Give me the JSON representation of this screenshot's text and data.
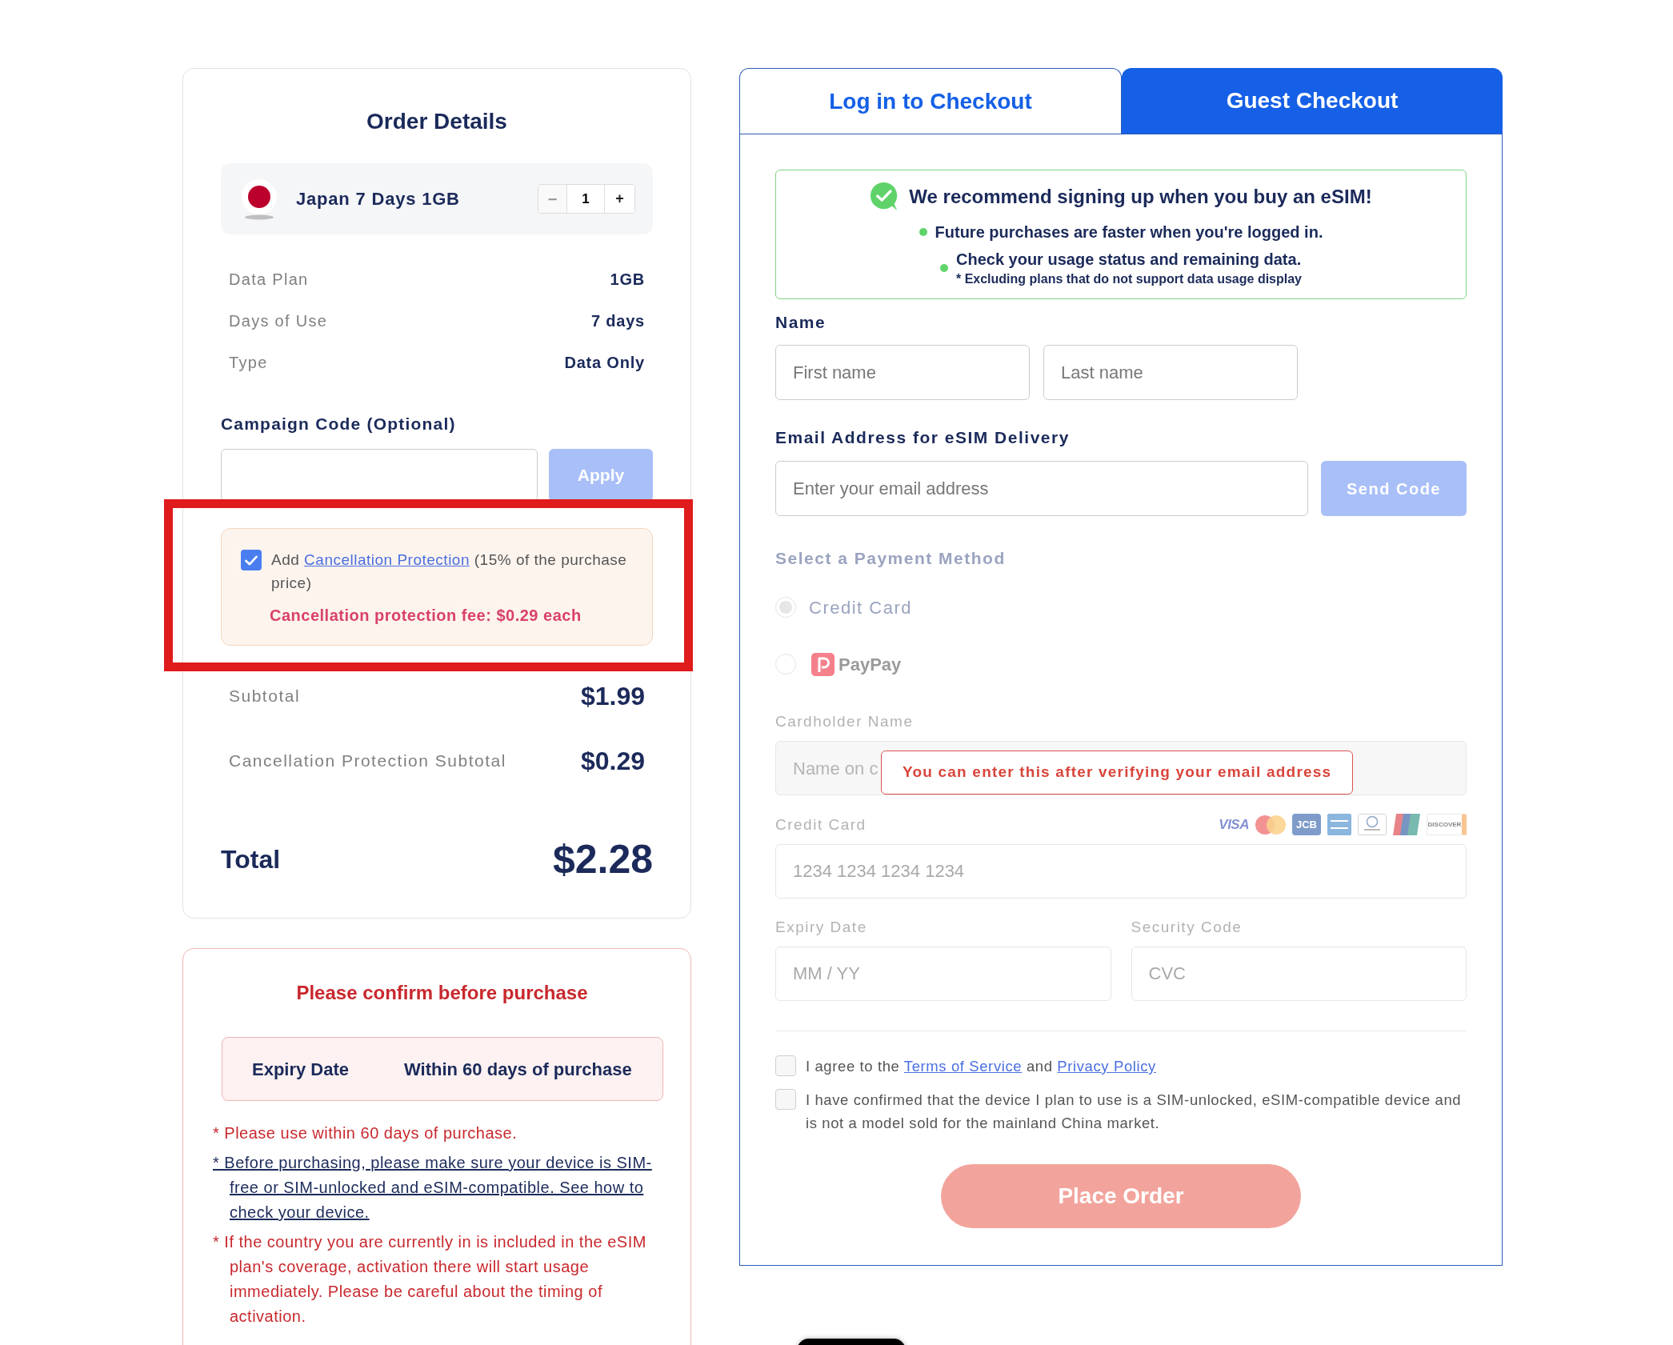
{
  "order_details": {
    "title": "Order Details",
    "product": {
      "name": "Japan 7 Days 1GB",
      "decrement": "−",
      "decrement_disabled": true,
      "quantity": "1",
      "increment": "+"
    },
    "specs": [
      {
        "label": "Data Plan",
        "value": "1GB"
      },
      {
        "label": "Days of Use",
        "value": "7 days"
      },
      {
        "label": "Type",
        "value": "Data Only"
      }
    ],
    "campaign_code": {
      "label": "Campaign Code (Optional)",
      "button": "Apply",
      "button_disabled": true
    },
    "cancellation_protection": {
      "checked": true,
      "highlighted": true,
      "text_before": "Add",
      "link": "Cancellation Protection",
      "text_after": "(15% of the purchase price)",
      "fee": "Cancellation protection fee: $0.29 each"
    },
    "summary": [
      {
        "label": "Subtotal",
        "value": "$1.99"
      },
      {
        "label": "Cancellation Protection Subtotal",
        "value": "$0.29"
      }
    ],
    "total": {
      "label": "Total",
      "value": "$2.28"
    }
  },
  "purchase_notice": {
    "title": "Please confirm before purchase",
    "expiry": {
      "label": "Expiry Date",
      "value": "Within 60 days of purchase"
    },
    "notes": [
      {
        "kind": "warning",
        "text": "* Please use within 60 days of purchase."
      },
      {
        "kind": "link",
        "text": "* Before purchasing, please make sure your device is SIM-free or SIM-unlocked and eSIM-compatible. See how to check your device."
      },
      {
        "kind": "warning",
        "text": "* If the country you are currently in is included in the eSIM plan's coverage, activation there will start usage immediately. Please be careful about the timing of activation."
      }
    ]
  },
  "checkout": {
    "tabs": [
      {
        "label": "Log in to Checkout",
        "selected": false
      },
      {
        "label": "Guest Checkout",
        "selected": true
      }
    ],
    "recommendation": {
      "title": "We recommend signing up when you buy an eSIM!",
      "points": [
        {
          "text": "Future purchases are faster when you're logged in."
        },
        {
          "text": "Check your usage status and remaining data.",
          "note": "* Excluding plans that do not support data usage display"
        }
      ]
    },
    "name": {
      "label": "Name",
      "fields": [
        {
          "placeholder": "First name"
        },
        {
          "placeholder": "Last name"
        }
      ]
    },
    "email": {
      "label": "Email Address for eSIM Delivery",
      "placeholder": "Enter your email address",
      "button": "Send Code",
      "button_disabled": true
    },
    "payment": {
      "label": "Select a Payment Method",
      "disabled": true,
      "methods": [
        {
          "kind": "card",
          "label": "Credit Card",
          "selected": true
        },
        {
          "kind": "paypay",
          "label": "PayPay",
          "selected": false
        }
      ],
      "cardholder": {
        "label": "Cardholder Name",
        "placeholder": "Name on c"
      },
      "lock_message": "You can enter this after verifying your email address",
      "card_number": {
        "label": "Credit Card",
        "placeholder": "1234 1234 1234 1234",
        "brands": [
          {
            "kind": "visa",
            "label": "VISA"
          },
          {
            "kind": "mastercard"
          },
          {
            "kind": "jcb",
            "label": "JCB"
          },
          {
            "kind": "amex"
          },
          {
            "kind": "diners"
          },
          {
            "kind": "unionpay"
          },
          {
            "kind": "discover",
            "label": "DISCOVER"
          }
        ]
      },
      "expiry": {
        "label": "Expiry Date",
        "placeholder": "MM / YY"
      },
      "security_code": {
        "label": "Security Code",
        "placeholder": "CVC"
      }
    },
    "consents": [
      {
        "checked": false,
        "segments": [
          {
            "kind": "text",
            "text": "I agree to the"
          },
          {
            "kind": "link",
            "text": "Terms of Service"
          },
          {
            "kind": "text",
            "text": "and"
          },
          {
            "kind": "link",
            "text": "Privacy Policy"
          }
        ]
      },
      {
        "checked": false,
        "segments": [
          {
            "kind": "text",
            "text": "I have confirmed that the device I plan to use is a SIM-unlocked, eSIM-compatible device and is not a model sold for the mainland China market."
          }
        ]
      }
    ],
    "place_order": {
      "label": "Place Order",
      "disabled": true
    }
  }
}
